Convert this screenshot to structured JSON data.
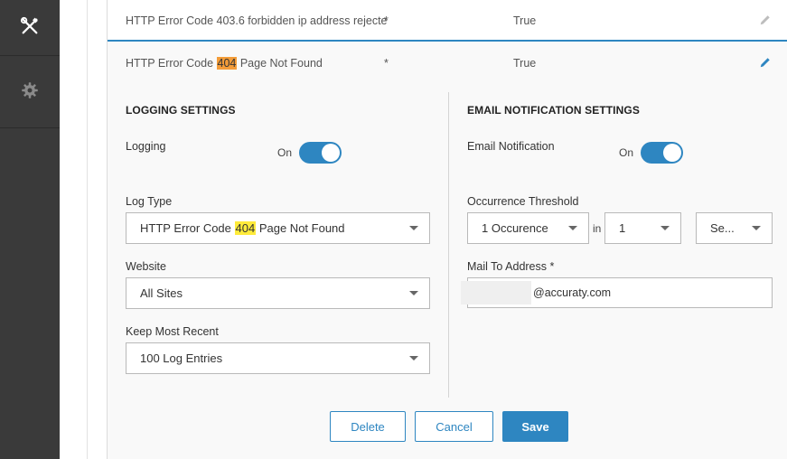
{
  "sidebar": {
    "items": [
      {
        "icon": "tools-icon"
      },
      {
        "icon": "gear-icon"
      }
    ]
  },
  "rows": [
    {
      "name": "HTTP Error Code 403.6 forbidden ip address rejecte",
      "star": "*",
      "value": "True",
      "edit_icon": "pencil-icon",
      "edit_color": "#bdbdbd"
    },
    {
      "name_prefix": "HTTP Error Code ",
      "name_highlight": "404",
      "name_suffix": " Page Not Found",
      "star": "*",
      "value": "True",
      "edit_icon": "pencil-icon",
      "edit_color": "#2e86c1",
      "highlight_color": "#f39c39"
    }
  ],
  "logging": {
    "title": "LOGGING SETTINGS",
    "logging_label": "Logging",
    "toggle_text": "On",
    "toggle_on": true,
    "log_type_label": "Log Type",
    "log_type_prefix": "HTTP Error Code ",
    "log_type_highlight": "404",
    "log_type_suffix": " Page Not Found",
    "highlight_color": "#ffeb3b",
    "website_label": "Website",
    "website_value": "All Sites",
    "keep_label": "Keep Most Recent",
    "keep_value": "100 Log Entries"
  },
  "email": {
    "title": "EMAIL NOTIFICATION SETTINGS",
    "notification_label": "Email Notification",
    "toggle_text": "On",
    "toggle_on": true,
    "threshold_label": "Occurrence Threshold",
    "occurrence_value": "1 Occurence",
    "in_text": "in",
    "count_value": "1",
    "unit_value": "Se...",
    "mail_label": "Mail To Address *",
    "mail_value": "@accuraty.com"
  },
  "actions": {
    "delete_label": "Delete",
    "cancel_label": "Cancel",
    "save_label": "Save"
  },
  "colors": {
    "accent": "#2e86c1",
    "sidebar": "#3a3a3a"
  }
}
